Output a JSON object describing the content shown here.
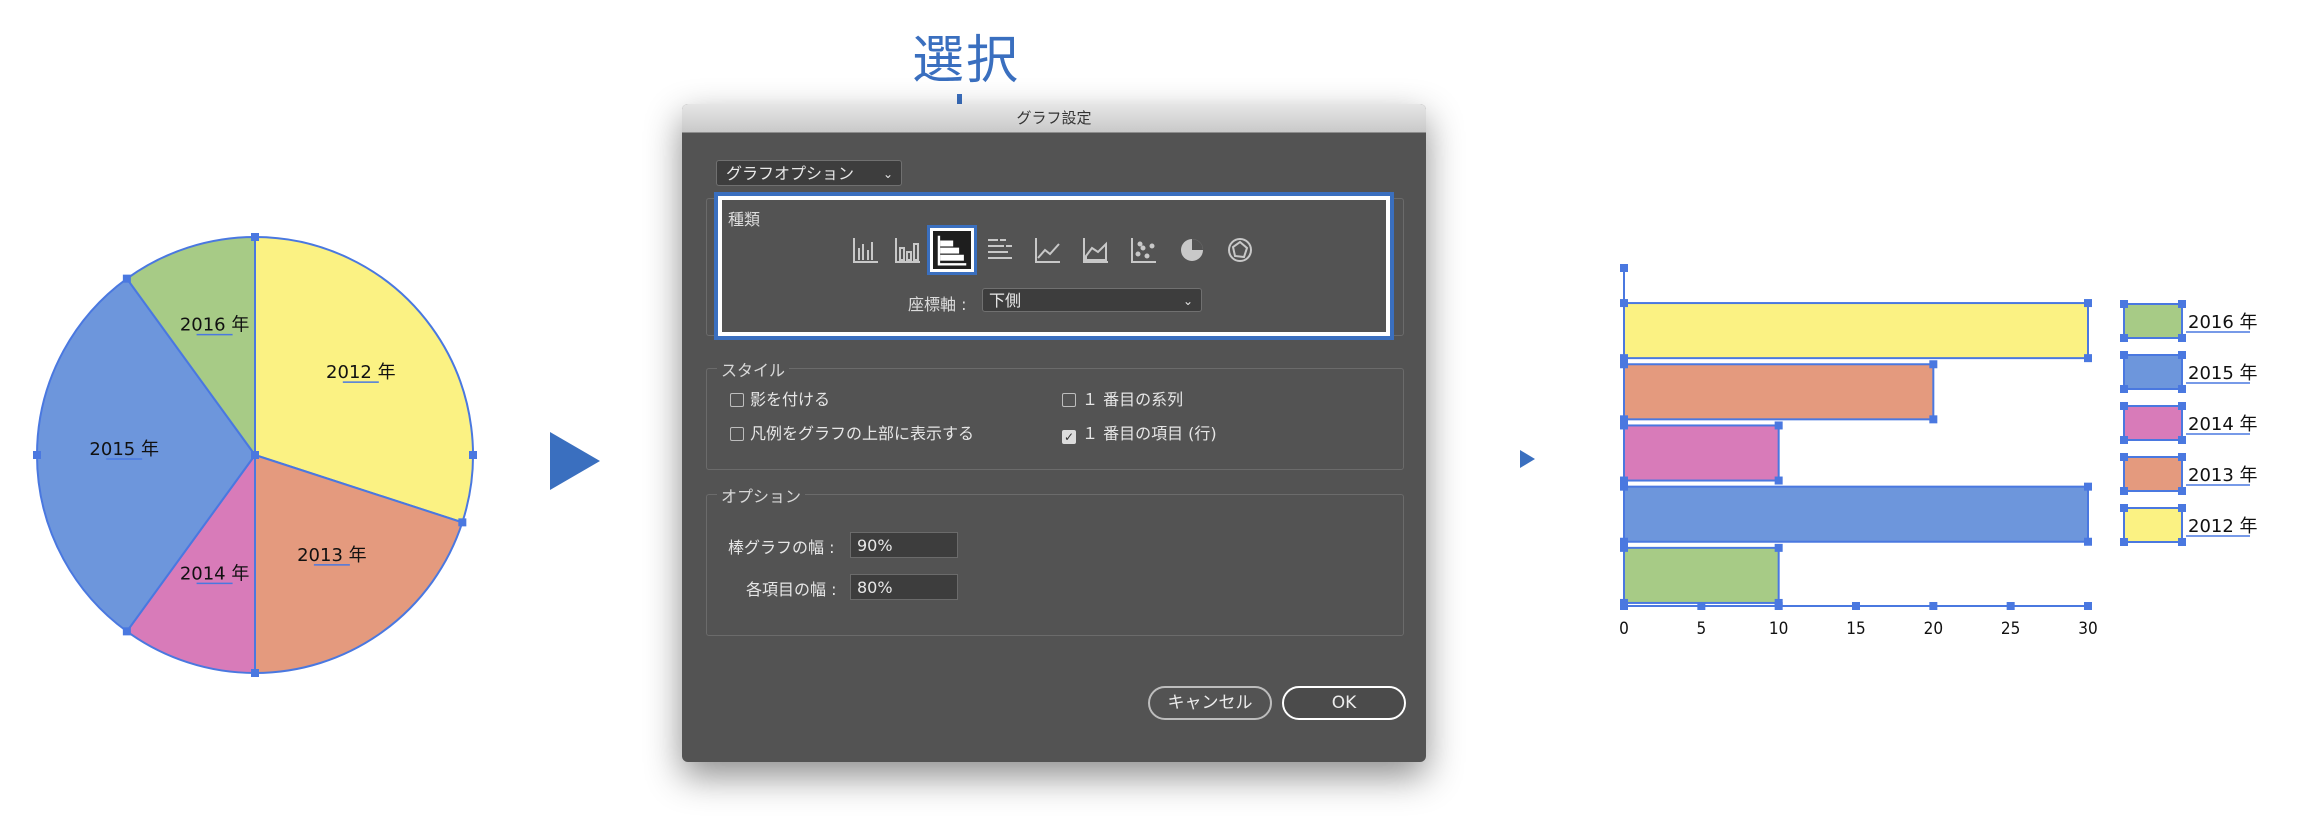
{
  "callout": {
    "label": "選択"
  },
  "pie": {
    "slices": [
      {
        "label": "2012 年",
        "value": 30,
        "color": "#fbf283"
      },
      {
        "label": "2013 年",
        "value": 20,
        "color": "#e49a7e"
      },
      {
        "label": "2014 年",
        "value": 10,
        "color": "#d87bb9"
      },
      {
        "label": "2015 年",
        "value": 30,
        "color": "#6d96dc"
      },
      {
        "label": "2016 年",
        "value": 10,
        "color": "#a7cb86"
      }
    ]
  },
  "dialog": {
    "title": "グラフ設定",
    "options_dropdown": "グラフオプション",
    "type_group": "種類",
    "type_icons": [
      "column-chart-icon",
      "stacked-column-chart-icon",
      "bar-chart-icon",
      "stacked-bar-chart-icon",
      "line-chart-icon",
      "area-chart-icon",
      "scatter-chart-icon",
      "pie-chart-icon",
      "radar-chart-icon"
    ],
    "selected_type": "bar-chart-icon",
    "axis_label": "座標軸 :",
    "axis_value": "下側",
    "style_group": "スタイル",
    "style_options": {
      "shadow": {
        "label": "影を付ける",
        "checked": false
      },
      "legend_top": {
        "label": "凡例をグラフの上部に表示する",
        "checked": false
      },
      "first_series": {
        "label": "１ 番目の系列",
        "checked": false
      },
      "first_item": {
        "label": "１ 番目の項目 (行)",
        "checked": true
      }
    },
    "options_group": "オプション",
    "bar_width_label": "棒グラフの幅 :",
    "bar_width_value": "90%",
    "item_width_label": "各項目の幅 :",
    "item_width_value": "80%",
    "cancel_label": "キャンセル",
    "ok_label": "OK"
  },
  "chart_data": {
    "type": "bar",
    "orientation": "horizontal",
    "categories": [
      "2016 年",
      "2015 年",
      "2014 年",
      "2013 年",
      "2012 年"
    ],
    "values": [
      30,
      20,
      10,
      30,
      10
    ],
    "colors": [
      "#fbf283",
      "#e49a7e",
      "#d87bb9",
      "#6d96dc",
      "#a7cb86"
    ],
    "xlim": [
      0,
      30
    ],
    "xticks": [
      "0",
      "5",
      "10",
      "15",
      "20",
      "25",
      "30"
    ],
    "legend": [
      {
        "label": "2016 年",
        "color": "#a7cb86"
      },
      {
        "label": "2015 年",
        "color": "#6d96dc"
      },
      {
        "label": "2014 年",
        "color": "#d87bb9"
      },
      {
        "label": "2013 年",
        "color": "#e49a7e"
      },
      {
        "label": "2012 年",
        "color": "#fbf283"
      }
    ],
    "legend_position": "right"
  }
}
